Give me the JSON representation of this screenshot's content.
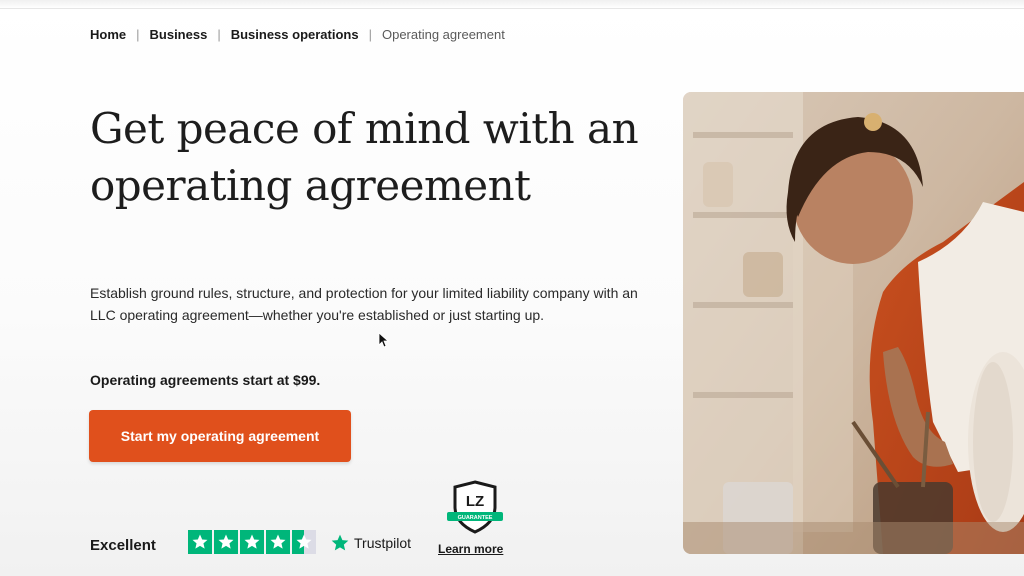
{
  "breadcrumb": {
    "items": [
      "Home",
      "Business",
      "Business operations"
    ],
    "current": "Operating agreement",
    "separator": "|"
  },
  "hero": {
    "headline": "Get peace of mind with an operating agreement",
    "description": "Establish ground rules, structure, and protection for your limited liability company with an LLC operating agreement—whether you're established or just starting up.",
    "price_note": "Operating agreements start at $99.",
    "cta_label": "Start my operating agreement"
  },
  "trust": {
    "rating_label": "Excellent",
    "stars": 4.5,
    "trustpilot_label": "Trustpilot",
    "badge_letters": "LZ",
    "badge_banner": "GUARANTEE",
    "learn_more": "Learn more"
  },
  "colors": {
    "cta": "#e0501c",
    "trustpilot_green": "#00b67a",
    "text": "#1a1a1a"
  },
  "icons": {
    "star": "star-icon",
    "trustpilot": "trustpilot-star-icon",
    "badge": "lz-guarantee-badge-icon",
    "cursor": "mouse-cursor-icon"
  }
}
